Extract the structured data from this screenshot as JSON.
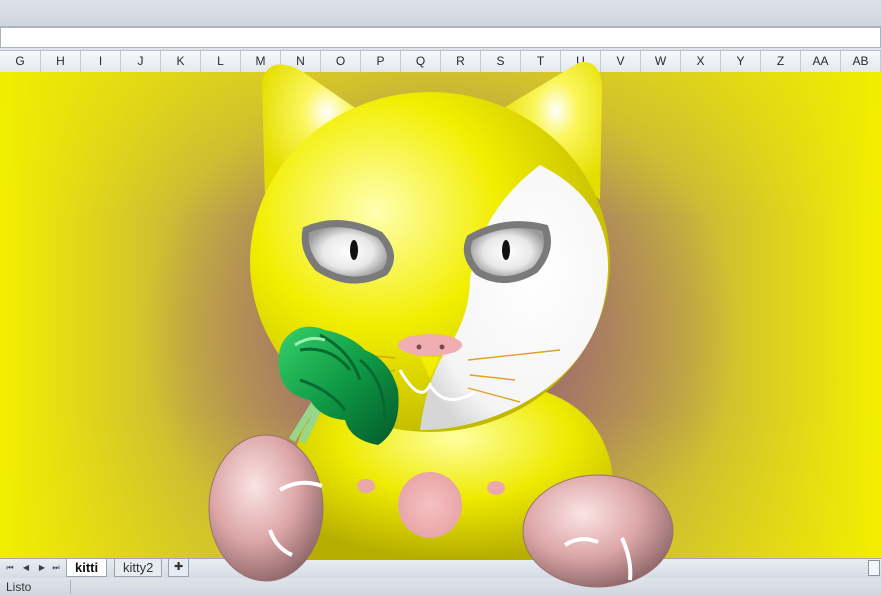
{
  "columns": [
    "G",
    "H",
    "I",
    "J",
    "K",
    "L",
    "M",
    "N",
    "O",
    "P",
    "Q",
    "R",
    "S",
    "T",
    "U",
    "V",
    "W",
    "X",
    "Y",
    "Z",
    "AA",
    "AB"
  ],
  "sheet_tabs": [
    "kitti",
    "kitty2"
  ],
  "active_tab": "kitti",
  "status": "Listo",
  "colors": {
    "cat_yellow": "#f2ee00",
    "cat_white": "#ffffff",
    "eye_ring": "#7a7a7a",
    "nose": "#f2b0b4",
    "broccoli": "#13a04a",
    "whisker": "#e0a020",
    "paw": "#e8b8b8"
  },
  "icons": {
    "first_sheet": "first-sheet-icon",
    "prev_sheet": "prev-sheet-icon",
    "next_sheet": "next-sheet-icon",
    "last_sheet": "last-sheet-icon",
    "insert_sheet": "insert-sheet-icon"
  }
}
